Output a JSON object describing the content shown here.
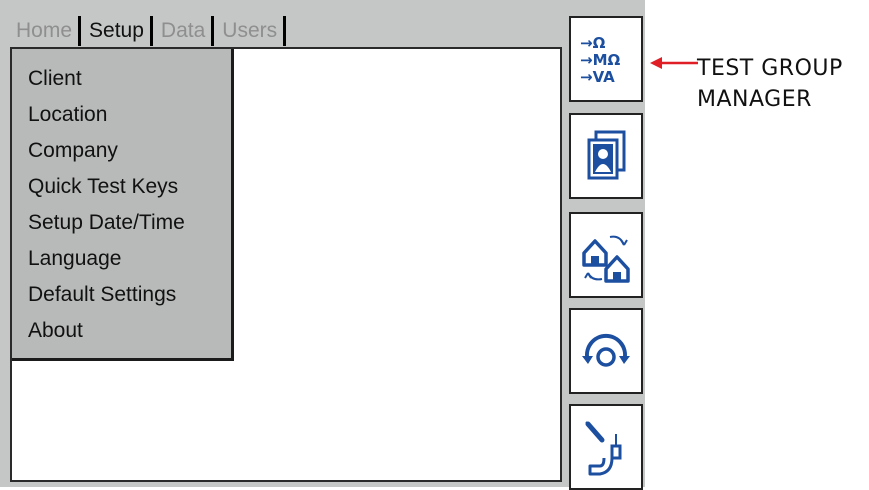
{
  "tabs": [
    {
      "label": "Home",
      "active": false
    },
    {
      "label": "Setup",
      "active": true
    },
    {
      "label": "Data",
      "active": false
    },
    {
      "label": "Users",
      "active": false
    }
  ],
  "setup_menu": {
    "items": [
      "Client",
      "Location",
      "Company",
      "Quick Test Keys",
      "Setup Date/Time",
      "Language",
      "Default Settings",
      "About"
    ]
  },
  "side_buttons": [
    {
      "icon": "test-group-manager-icon",
      "glyph_lines": [
        "→Ω",
        "→MΩ",
        "→VA"
      ]
    },
    {
      "icon": "user-profile-icon"
    },
    {
      "icon": "transfer-site-icon"
    },
    {
      "icon": "restart-icon"
    },
    {
      "icon": "probe-tool-icon"
    }
  ],
  "callout": {
    "line1": "TEST GROUP",
    "line2": "MANAGER"
  },
  "colors": {
    "screen_bg": "#c5c6c6",
    "icon_blue": "#1d4fa0",
    "callout_arrow": "#e01e25"
  }
}
